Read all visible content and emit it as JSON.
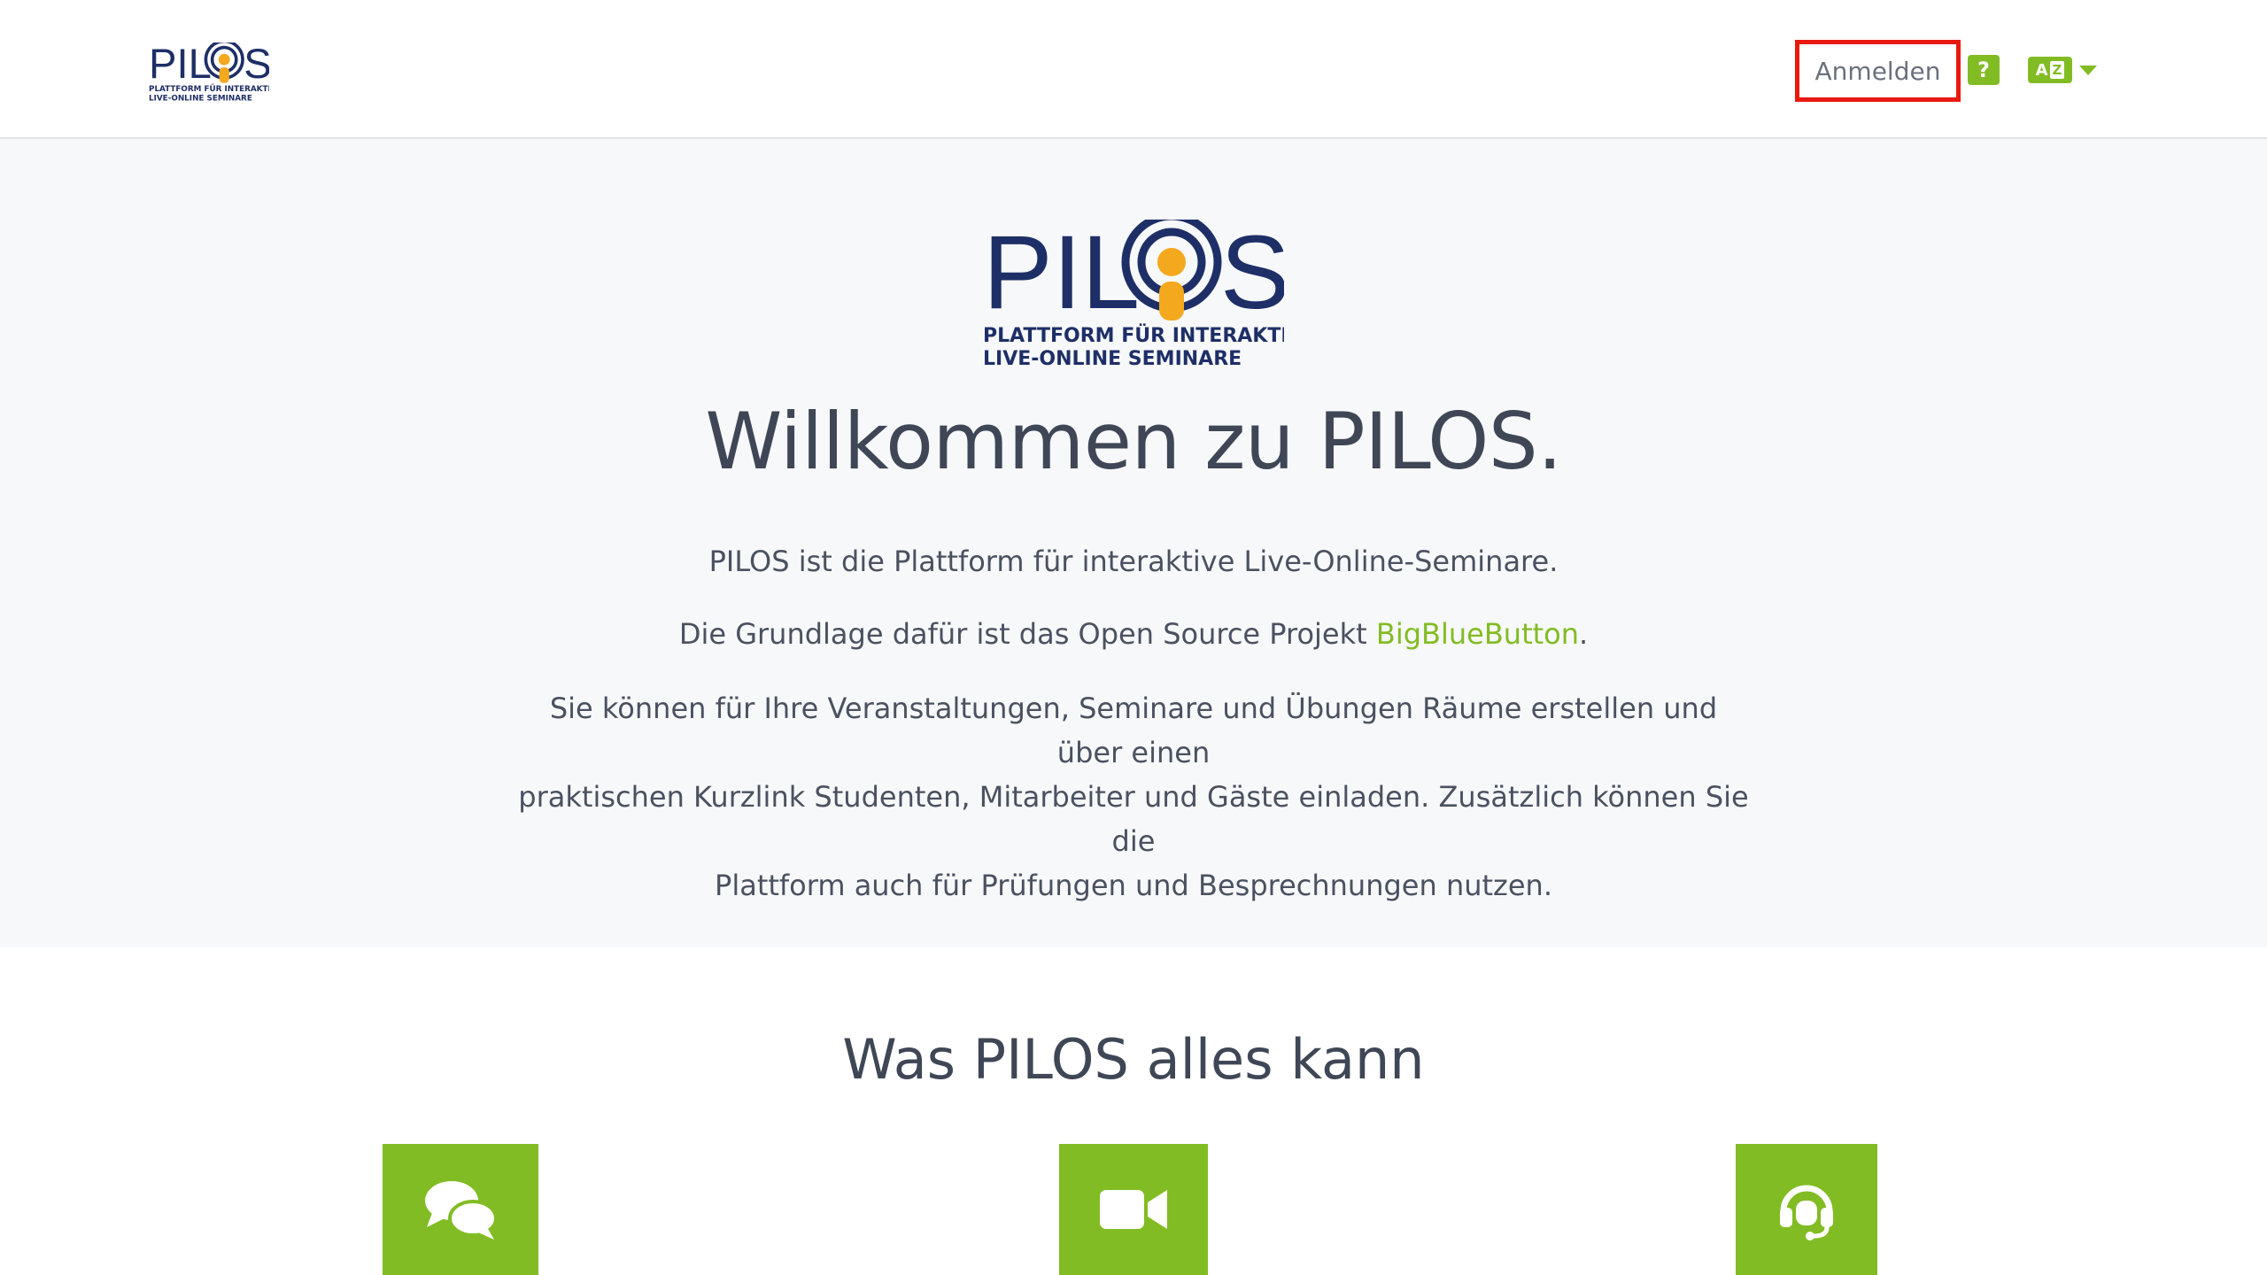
{
  "brand": {
    "name": "PILOS",
    "tagline_line1": "PLATTFORM FÜR INTERAKTIVE",
    "tagline_line2": "LIVE-ONLINE SEMINARE",
    "color_dark": "#1e2f67",
    "color_accent": "#f4a81d"
  },
  "nav": {
    "login_label": "Anmelden",
    "help_label": "?",
    "lang_icon_a": "A",
    "lang_icon_z": "Z",
    "accent_color": "#82bc24"
  },
  "hero": {
    "title": "Willkommen zu PILOS.",
    "paragraph1": "PILOS ist die Plattform für interaktive Live-Online-Seminare.",
    "paragraph2_prefix": "Die Grundlage dafür ist das Open Source Projekt ",
    "paragraph2_link": "BigBlueButton",
    "paragraph2_suffix": ".",
    "paragraph3_line1": "Sie können für Ihre Veranstaltungen, Seminare und Übungen Räume erstellen und über einen",
    "paragraph3_line2": "praktischen Kurzlink Studenten, Mitarbeiter und Gäste einladen. Zusätzlich können Sie die",
    "paragraph3_line3": "Plattform auch für Prüfungen und Besprechnungen nutzen."
  },
  "features": {
    "title": "Was PILOS alles kann",
    "tiles": [
      {
        "icon": "chat-bubbles-icon"
      },
      {
        "icon": "video-camera-icon"
      },
      {
        "icon": "headset-icon"
      }
    ]
  }
}
